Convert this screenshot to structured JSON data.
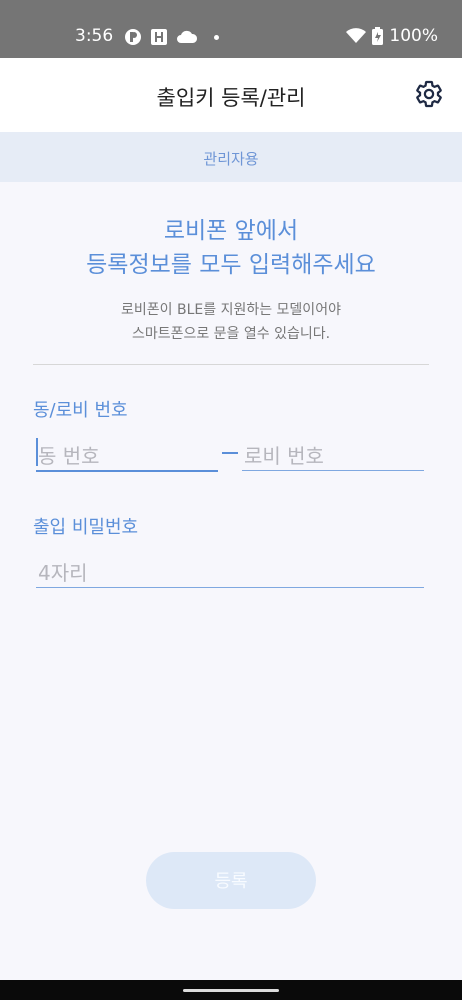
{
  "status_bar": {
    "time": "3:56",
    "battery": "100%"
  },
  "app_bar": {
    "title": "출입키 등록/관리"
  },
  "admin_bar": {
    "label": "관리자용"
  },
  "headline": {
    "line1": "로비폰 앞에서",
    "line2": "등록정보를 모두 입력해주세요"
  },
  "subtext": {
    "line1": "로비폰이 BLE를 지원하는 모델이어야",
    "line2": "스마트폰으로 문을 열수 있습니다."
  },
  "form": {
    "dong_lobby": {
      "label": "동/로비 번호",
      "dong_placeholder": "동 번호",
      "separator": "–",
      "lobby_placeholder": "로비 번호"
    },
    "password": {
      "label": "출입 비밀번호",
      "placeholder": "4자리"
    }
  },
  "register_button": {
    "label": "등록"
  },
  "colors": {
    "accent": "#5b8fd9",
    "status_bar": "#757575",
    "admin_bar": "#e6ecf6",
    "button_disabled": "#dde8f7"
  }
}
